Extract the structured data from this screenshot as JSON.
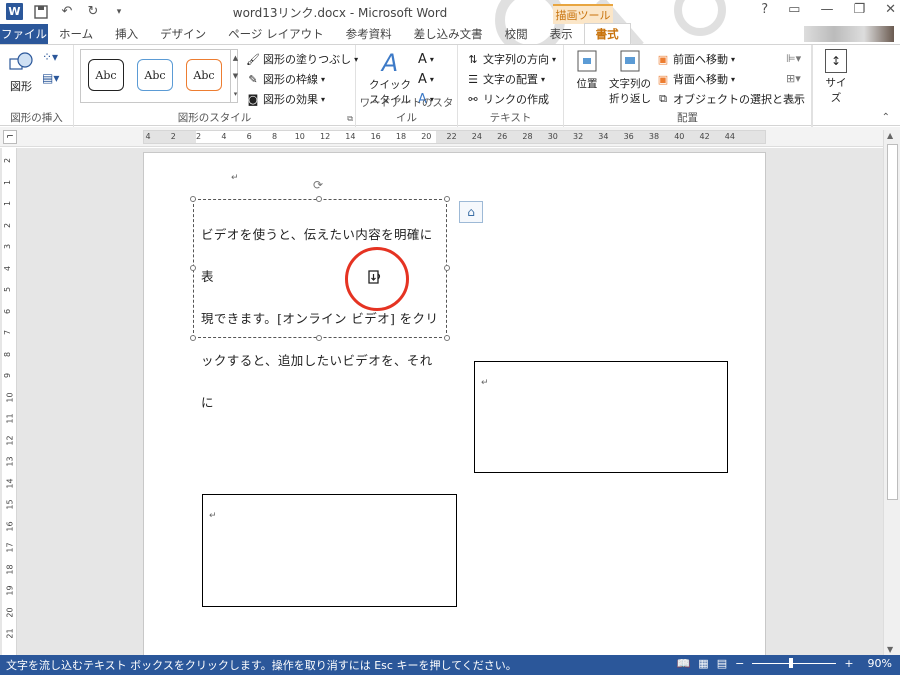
{
  "titlebar": {
    "title": "word13リンク.docx - Microsoft Word",
    "logo": "W",
    "minimize": "—",
    "restore": "❐",
    "close": "✕",
    "help": "?"
  },
  "tool_group": "描画ツール",
  "tabs": [
    "ファイル",
    "ホーム",
    "挿入",
    "デザイン",
    "ページ レイアウト",
    "参考資料",
    "差し込み文書",
    "校閲",
    "表示",
    "書式"
  ],
  "ribbon": {
    "insert_shapes": {
      "label": "図形の挿入",
      "shape_btn": "図形"
    },
    "shape_styles": {
      "label": "図形のスタイル",
      "abc": [
        "Abc",
        "Abc",
        "Abc"
      ],
      "fill": "図形の塗りつぶし",
      "outline": "図形の枠線",
      "effects": "図形の効果"
    },
    "wordart": {
      "label": "ワードアートのスタイル",
      "quick": "クイック",
      "quick2": "スタイル"
    },
    "text": {
      "label": "テキスト",
      "direction": "文字列の方向",
      "align": "文字の配置",
      "link": "リンクの作成"
    },
    "arrange": {
      "label": "配置",
      "position": "位置",
      "wrap1": "文字列の",
      "wrap2": "折り返し",
      "forward": "前面へ移動",
      "backward": "背面へ移動",
      "selection": "オブジェクトの選択と表示"
    },
    "size": {
      "label": "サイズ"
    }
  },
  "ruler": {
    "ticks": [
      "4",
      "2",
      "2",
      "4",
      "6",
      "8",
      "10",
      "12",
      "14",
      "16",
      "18",
      "20",
      "22",
      "24",
      "26",
      "28",
      "30",
      "32",
      "34",
      "36",
      "38",
      "40",
      "42",
      "44"
    ]
  },
  "vruler": {
    "ticks": [
      "2",
      "1",
      "1",
      "2",
      "3",
      "4",
      "5",
      "6",
      "7",
      "8",
      "9",
      "10",
      "11",
      "12",
      "13",
      "14",
      "15",
      "16",
      "17",
      "18",
      "19",
      "20",
      "21"
    ]
  },
  "document": {
    "para_mark": "↵",
    "textbox1_lines": [
      "ビデオを使うと、伝えたい内容を明確に表",
      "現できます。[オンライン ビデオ] をクリ",
      "ックすると、追加したいビデオを、それに"
    ]
  },
  "statusbar": {
    "message": "文字を流し込むテキスト ボックスをクリックします。操作を取り消すには Esc キーを押してください。",
    "zoom_minus": "−",
    "zoom_plus": "+",
    "zoom": "90%"
  }
}
